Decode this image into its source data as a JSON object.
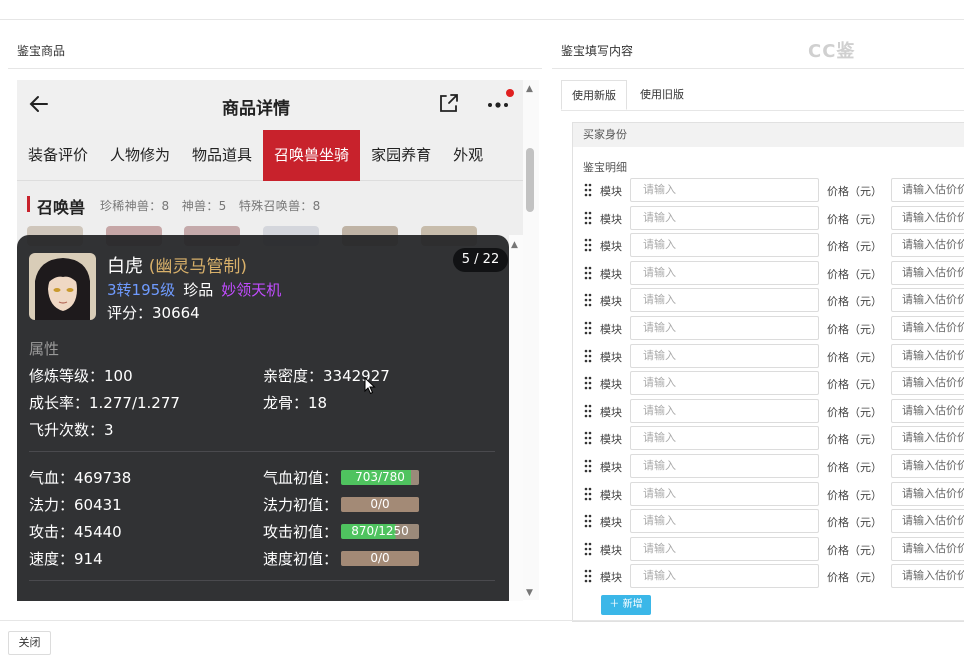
{
  "left_panel": {
    "title": "鉴宝商品"
  },
  "right_panel": {
    "title": "鉴宝填写内容"
  },
  "watermark": "CC鉴",
  "phone": {
    "title": "商品详情",
    "tabs": [
      "装备评价",
      "人物修为",
      "物品道具",
      "召唤兽坐骑",
      "家园养育",
      "外观"
    ],
    "active_tab": "召唤兽坐骑",
    "summon_title": "召唤兽",
    "summon_counts": "珍稀神兽：8　神兽：5　特殊召唤兽：8"
  },
  "pet": {
    "name": "白虎",
    "subtitle": "(幽灵马管制)",
    "pager": "5 / 22",
    "level": "3转195级",
    "rarity": "珍品",
    "skill": "妙领天机",
    "score": "评分：30664",
    "attr_head": "属性",
    "stats": {
      "cultivation": "修炼等级：100",
      "intimacy": "亲密度：3342927",
      "growth": "成长率：1.277/1.277",
      "dragon_bone": "龙骨：18",
      "ascension": "飞升次数：3",
      "hp": "气血：469738",
      "hp_init_label": "气血初值：",
      "mp": "法力：60431",
      "mp_init_label": "法力初值：",
      "atk": "攻击：45440",
      "atk_init_label": "攻击初值：",
      "spd": "速度：914",
      "spd_init_label": "速度初值："
    },
    "bars": {
      "hp": {
        "text": "703/780",
        "fill": 0.9,
        "color": "#4fc35f"
      },
      "mp": {
        "text": "0/0",
        "fill": 0,
        "color": "#a38a76"
      },
      "atk": {
        "text": "870/1250",
        "fill": 0.7,
        "color": "#4fc35f"
      },
      "spd": {
        "text": "0/0",
        "fill": 0,
        "color": "#a38a76"
      }
    }
  },
  "form": {
    "tab_new": "使用新版",
    "tab_old": "使用旧版",
    "buyer_label": "买家身份",
    "detail_label": "鉴宝明细",
    "module_label": "模块",
    "input_placeholder": "请输入",
    "price_label": "价格（元）",
    "price_placeholder": "请输入估价价",
    "row_count": 15,
    "add_label": "新增"
  },
  "footer": {
    "close_label": "关闭"
  }
}
